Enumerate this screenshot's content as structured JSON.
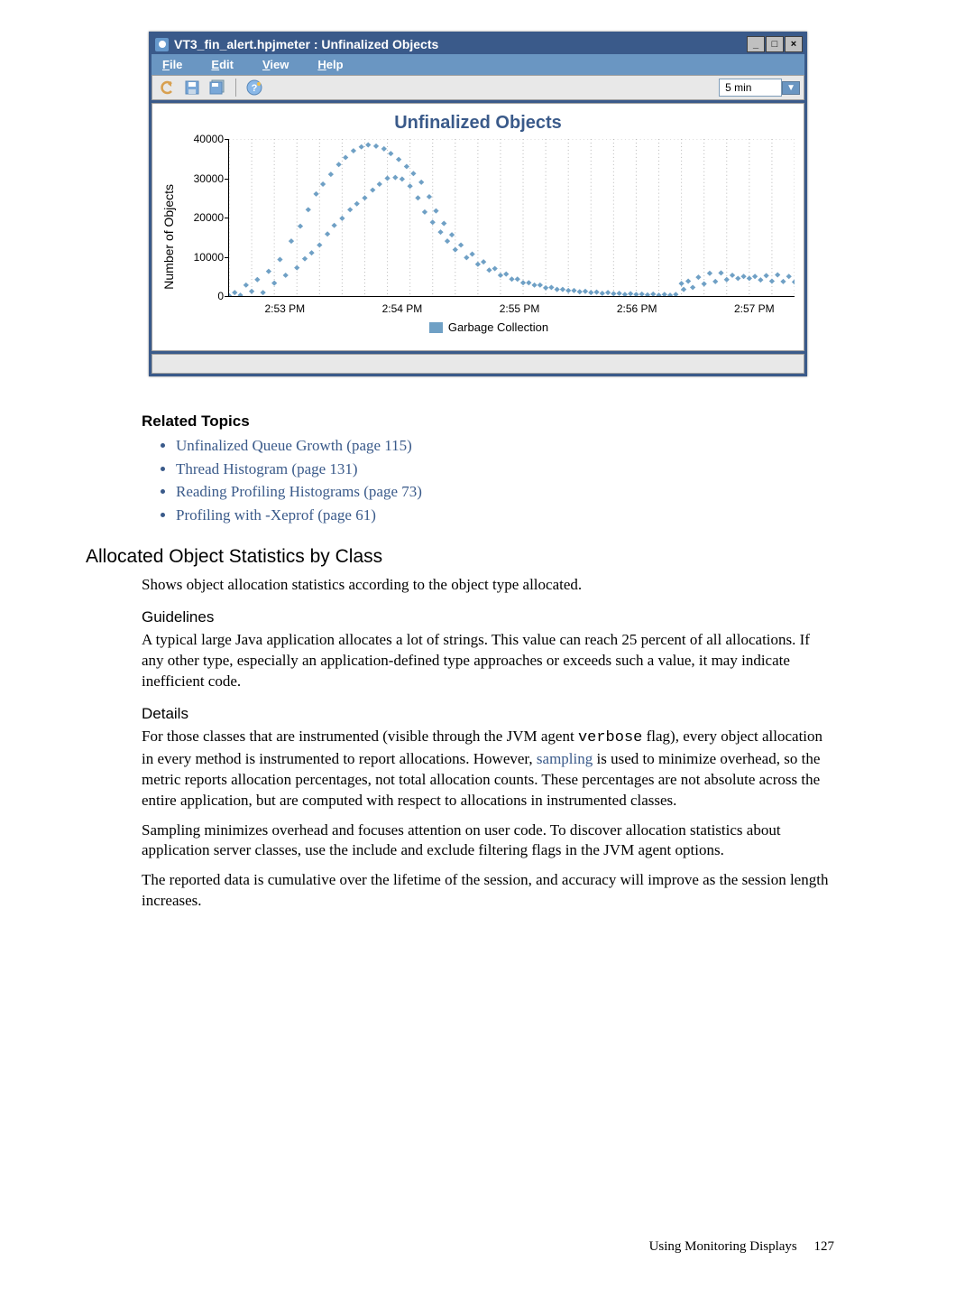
{
  "app_window": {
    "title": "VT3_fin_alert.hpjmeter : Unfinalized Objects",
    "menus": {
      "file": "File",
      "edit": "Edit",
      "view": "View",
      "help": "Help"
    },
    "win_buttons": {
      "min": "_",
      "max": "□",
      "close": "×"
    },
    "interval_selected": "5 min",
    "status_text": ""
  },
  "chart_data": {
    "type": "scatter",
    "title": "Unfinalized Objects",
    "ylabel": "Number of Objects",
    "ylim": [
      0,
      40000
    ],
    "xlim_minutes": [
      0,
      5
    ],
    "legend_label": "Garbage Collection",
    "yticks": [
      0,
      10000,
      20000,
      30000,
      40000
    ],
    "xticks": [
      "2:53 PM",
      "2:54 PM",
      "2:55 PM",
      "2:56 PM",
      "2:57 PM"
    ],
    "series": [
      {
        "name": "Garbage Collection",
        "color": "#6fa0c5",
        "points": [
          [
            0.0,
            100
          ],
          [
            0.05,
            900
          ],
          [
            0.1,
            200
          ],
          [
            0.15,
            2800
          ],
          [
            0.2,
            1200
          ],
          [
            0.25,
            4200
          ],
          [
            0.3,
            900
          ],
          [
            0.35,
            6300
          ],
          [
            0.4,
            3300
          ],
          [
            0.45,
            9300
          ],
          [
            0.5,
            5300
          ],
          [
            0.55,
            14000
          ],
          [
            0.6,
            7200
          ],
          [
            0.63,
            17800
          ],
          [
            0.67,
            9500
          ],
          [
            0.7,
            22000
          ],
          [
            0.73,
            11000
          ],
          [
            0.77,
            26000
          ],
          [
            0.8,
            13000
          ],
          [
            0.83,
            28500
          ],
          [
            0.87,
            15800
          ],
          [
            0.9,
            31000
          ],
          [
            0.93,
            18000
          ],
          [
            0.97,
            33500
          ],
          [
            1.0,
            19800
          ],
          [
            1.03,
            35300
          ],
          [
            1.07,
            22000
          ],
          [
            1.1,
            37000
          ],
          [
            1.13,
            23500
          ],
          [
            1.17,
            38000
          ],
          [
            1.2,
            25000
          ],
          [
            1.23,
            38500
          ],
          [
            1.27,
            27000
          ],
          [
            1.3,
            38200
          ],
          [
            1.33,
            28500
          ],
          [
            1.37,
            37500
          ],
          [
            1.4,
            30000
          ],
          [
            1.43,
            36300
          ],
          [
            1.47,
            30200
          ],
          [
            1.5,
            34800
          ],
          [
            1.53,
            29800
          ],
          [
            1.57,
            33000
          ],
          [
            1.6,
            28000
          ],
          [
            1.63,
            31200
          ],
          [
            1.67,
            25000
          ],
          [
            1.7,
            29000
          ],
          [
            1.73,
            21400
          ],
          [
            1.77,
            25300
          ],
          [
            1.8,
            18800
          ],
          [
            1.83,
            21700
          ],
          [
            1.87,
            16300
          ],
          [
            1.9,
            18500
          ],
          [
            1.93,
            14000
          ],
          [
            1.97,
            15600
          ],
          [
            2.0,
            11800
          ],
          [
            2.05,
            13000
          ],
          [
            2.1,
            9800
          ],
          [
            2.15,
            10700
          ],
          [
            2.2,
            8100
          ],
          [
            2.25,
            8700
          ],
          [
            2.3,
            6600
          ],
          [
            2.35,
            7000
          ],
          [
            2.4,
            5300
          ],
          [
            2.45,
            5600
          ],
          [
            2.5,
            4300
          ],
          [
            2.55,
            4300
          ],
          [
            2.6,
            3400
          ],
          [
            2.65,
            3400
          ],
          [
            2.7,
            2800
          ],
          [
            2.75,
            2800
          ],
          [
            2.8,
            2100
          ],
          [
            2.85,
            2200
          ],
          [
            2.9,
            1700
          ],
          [
            2.95,
            1700
          ],
          [
            3.0,
            1400
          ],
          [
            3.05,
            1400
          ],
          [
            3.1,
            1100
          ],
          [
            3.15,
            1200
          ],
          [
            3.2,
            900
          ],
          [
            3.25,
            1000
          ],
          [
            3.3,
            700
          ],
          [
            3.35,
            900
          ],
          [
            3.4,
            600
          ],
          [
            3.45,
            700
          ],
          [
            3.5,
            400
          ],
          [
            3.55,
            600
          ],
          [
            3.6,
            400
          ],
          [
            3.65,
            500
          ],
          [
            3.7,
            300
          ],
          [
            3.75,
            500
          ],
          [
            3.8,
            200
          ],
          [
            3.85,
            400
          ],
          [
            3.9,
            200
          ],
          [
            3.95,
            400
          ],
          [
            4.0,
            3200
          ],
          [
            4.02,
            1700
          ],
          [
            4.06,
            3800
          ],
          [
            4.1,
            2200
          ],
          [
            4.15,
            4800
          ],
          [
            4.2,
            3100
          ],
          [
            4.25,
            5800
          ],
          [
            4.3,
            3700
          ],
          [
            4.35,
            5900
          ],
          [
            4.4,
            4200
          ],
          [
            4.45,
            5300
          ],
          [
            4.5,
            4500
          ],
          [
            4.55,
            5000
          ],
          [
            4.6,
            4500
          ],
          [
            4.65,
            5000
          ],
          [
            4.7,
            4100
          ],
          [
            4.75,
            5200
          ],
          [
            4.8,
            3800
          ],
          [
            4.85,
            5400
          ],
          [
            4.9,
            3700
          ],
          [
            4.95,
            5000
          ],
          [
            5.0,
            3600
          ]
        ]
      }
    ]
  },
  "related_topics_heading": "Related Topics",
  "links": {
    "l0": "Unfinalized Queue Growth (page 115)",
    "l1": "Thread Histogram (page 131)",
    "l2": "Reading Profiling Histograms (page 73)",
    "l3": "Profiling with -Xeprof (page 61)"
  },
  "section": {
    "title": "Allocated Object Statistics by Class",
    "intro": "Shows object allocation statistics according to the object type allocated.",
    "guidelines_heading": "Guidelines",
    "guidelines": "A typical large Java application allocates a lot of strings. This value can reach 25 percent of all allocations. If any other type, especially an application-defined type approaches or exceeds such a value, it may indicate inefficient code.",
    "details_heading": "Details",
    "details1_pre": "For those classes that are instrumented (visible through the JVM agent ",
    "details1_code": "verbose",
    "details1_mid": " flag), every object allocation in every method is instrumented to report allocations. However, ",
    "details1_link": "sampling",
    "details1_post": " is used to minimize overhead, so the metric reports allocation percentages, not total allocation counts. These percentages are not absolute across the entire application, but are computed with respect to allocations in instrumented classes.",
    "details2": "Sampling minimizes overhead and focuses attention on user code. To discover allocation statistics about application server classes, use the include and exclude filtering flags in the JVM agent options.",
    "details3": "The reported data is cumulative over the lifetime of the session, and accuracy will improve as the session length increases."
  },
  "footer": {
    "text": "Using Monitoring Displays",
    "page": "127"
  }
}
